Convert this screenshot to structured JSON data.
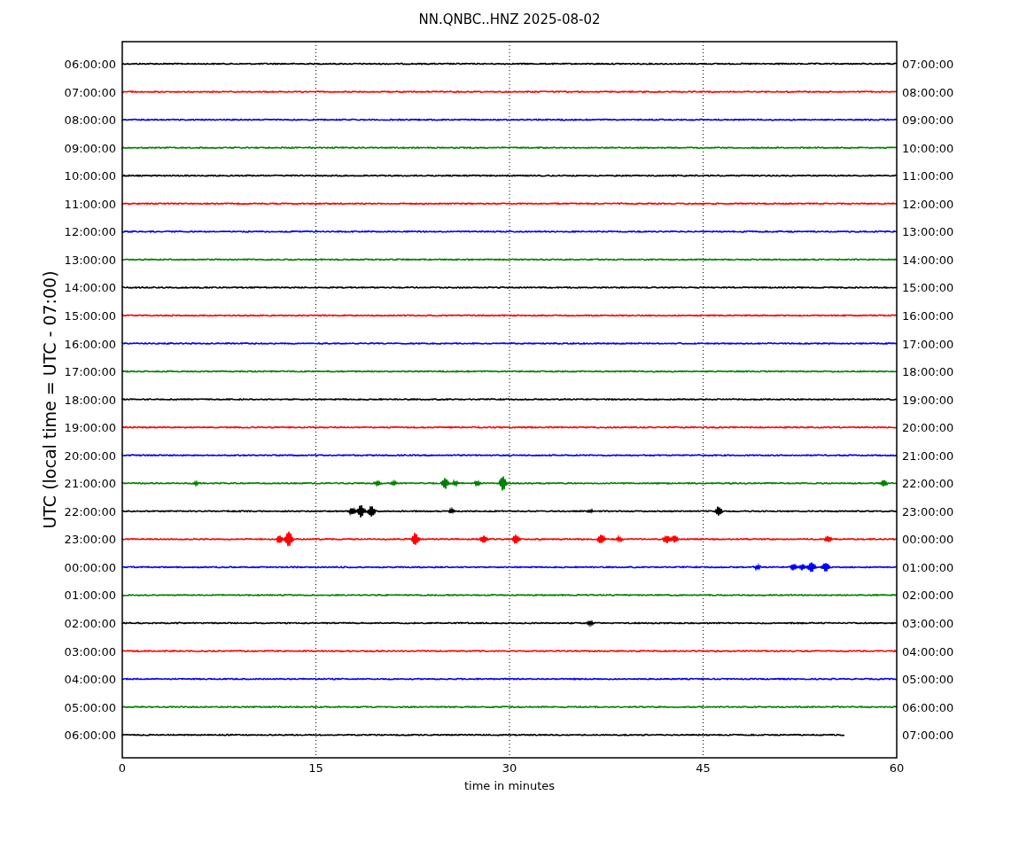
{
  "title": "NN.QNBC..HNZ 2025-08-02",
  "y_axis": {
    "label": "UTC (local time = UTC - 07:00)"
  },
  "x_axis": {
    "label": "time in minutes",
    "ticks": [
      "0",
      "15",
      "30",
      "45",
      "60"
    ]
  },
  "traces": [
    {
      "left_label": "06:00:00",
      "right_label": "07:00:00",
      "color": "#000000",
      "level": 1
    },
    {
      "left_label": "07:00:00",
      "right_label": "08:00:00",
      "color": "#ff0000",
      "level": 1
    },
    {
      "left_label": "08:00:00",
      "right_label": "09:00:00",
      "color": "#0000ff",
      "level": 1
    },
    {
      "left_label": "09:00:00",
      "right_label": "10:00:00",
      "color": "#008000",
      "level": 1
    },
    {
      "left_label": "10:00:00",
      "right_label": "11:00:00",
      "color": "#000000",
      "level": 1
    },
    {
      "left_label": "11:00:00",
      "right_label": "12:00:00",
      "color": "#ff0000",
      "level": 1
    },
    {
      "left_label": "12:00:00",
      "right_label": "13:00:00",
      "color": "#0000ff",
      "level": 1
    },
    {
      "left_label": "13:00:00",
      "right_label": "14:00:00",
      "color": "#008000",
      "level": 1
    },
    {
      "left_label": "14:00:00",
      "right_label": "15:00:00",
      "color": "#000000",
      "level": 1
    },
    {
      "left_label": "15:00:00",
      "right_label": "16:00:00",
      "color": "#ff0000",
      "level": 1
    },
    {
      "left_label": "16:00:00",
      "right_label": "17:00:00",
      "color": "#0000ff",
      "level": 1
    },
    {
      "left_label": "17:00:00",
      "right_label": "18:00:00",
      "color": "#008000",
      "level": 1
    },
    {
      "left_label": "18:00:00",
      "right_label": "19:00:00",
      "color": "#000000",
      "level": 1
    },
    {
      "left_label": "19:00:00",
      "right_label": "20:00:00",
      "color": "#ff0000",
      "level": 1
    },
    {
      "left_label": "20:00:00",
      "right_label": "21:00:00",
      "color": "#0000ff",
      "level": 1
    },
    {
      "left_label": "21:00:00",
      "right_label": "22:00:00",
      "color": "#008000",
      "level": 1
    },
    {
      "left_label": "22:00:00",
      "right_label": "23:00:00",
      "color": "#000000",
      "level": 1
    },
    {
      "left_label": "23:00:00",
      "right_label": "00:00:00",
      "color": "#ff0000",
      "level": 1
    },
    {
      "left_label": "00:00:00",
      "right_label": "01:00:00",
      "color": "#0000ff",
      "level": 1
    },
    {
      "left_label": "01:00:00",
      "right_label": "02:00:00",
      "color": "#008000",
      "level": 1
    },
    {
      "left_label": "02:00:00",
      "right_label": "03:00:00",
      "color": "#000000",
      "level": 1
    },
    {
      "left_label": "03:00:00",
      "right_label": "04:00:00",
      "color": "#ff0000",
      "level": 1
    },
    {
      "left_label": "04:00:00",
      "right_label": "05:00:00",
      "color": "#0000ff",
      "level": 1
    },
    {
      "left_label": "05:00:00",
      "right_label": "06:00:00",
      "color": "#008000",
      "level": 1
    },
    {
      "left_label": "06:00:00",
      "right_label": "07:00:00",
      "color": "#000000",
      "level": 0.933
    }
  ]
}
